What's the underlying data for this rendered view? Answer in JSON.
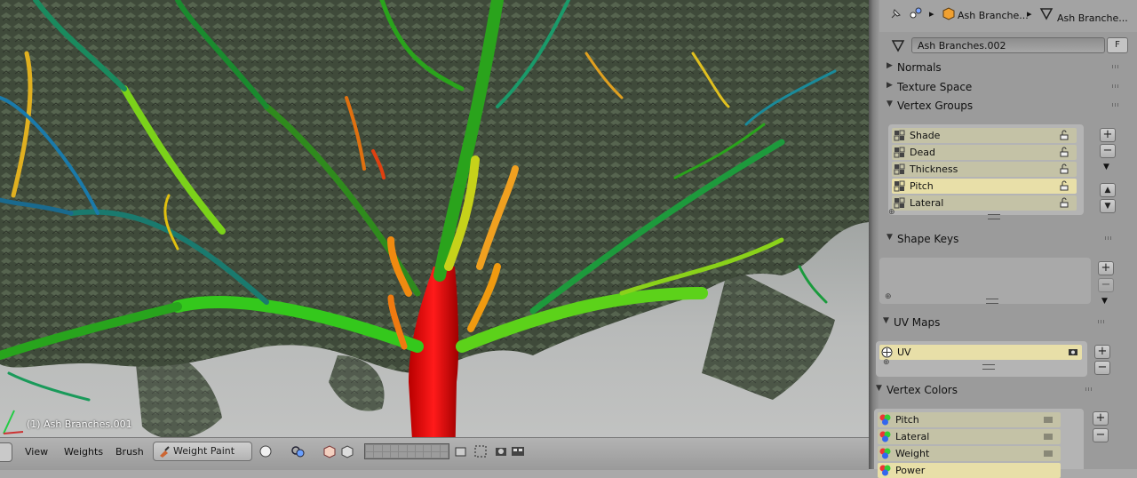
{
  "viewport": {
    "object_label": "(1) Ash Branches.001"
  },
  "header": {
    "menus": [
      "View",
      "Weights",
      "Brush"
    ],
    "mode": "Weight Paint"
  },
  "properties": {
    "breadcrumb": [
      "Ash Branche...",
      "Ash Branche..."
    ],
    "data_name": "Ash Branches.002",
    "fake_user_label": "F",
    "sections": {
      "normals": "Normals",
      "texture_space": "Texture Space",
      "vertex_groups": "Vertex Groups",
      "shape_keys": "Shape Keys",
      "uv_maps": "UV Maps",
      "vertex_colors": "Vertex Colors"
    },
    "vertex_groups": [
      "Shade",
      "Dead",
      "Thickness",
      "Pitch",
      "Lateral"
    ],
    "vertex_groups_selected": "Pitch",
    "uv_maps": [
      "UV"
    ],
    "vertex_colors": [
      "Pitch",
      "Lateral",
      "Weight",
      "Power"
    ],
    "icons": {
      "add": "plus-icon",
      "remove": "minus-icon",
      "menu": "dropdown-arrow-icon",
      "move_up": "arrow-up-icon",
      "move_down": "arrow-down-icon"
    }
  }
}
